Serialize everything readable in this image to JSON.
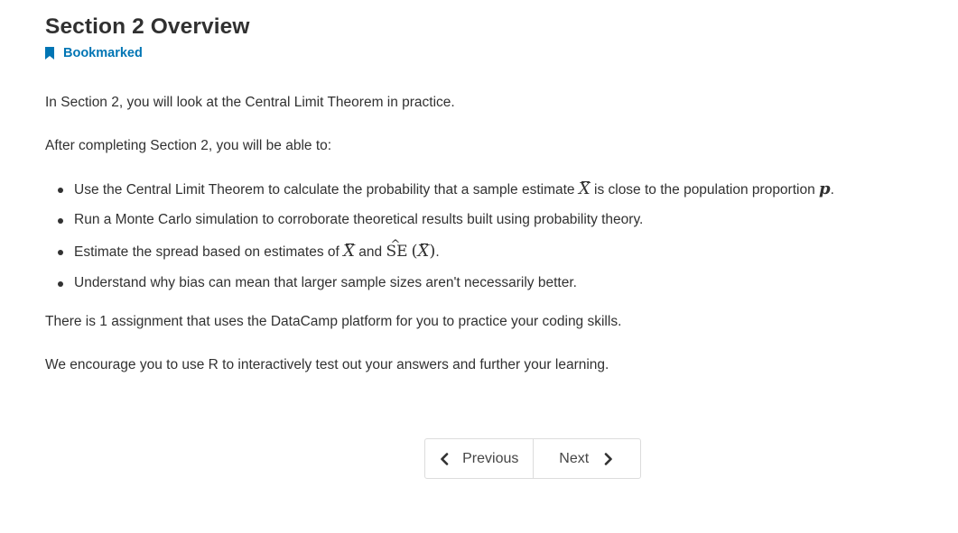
{
  "header": {
    "title": "Section 2 Overview",
    "bookmark_label": "Bookmarked",
    "bookmark_icon": "bookmark-icon"
  },
  "content": {
    "intro": "In Section 2, you will look at the Central Limit Theorem in practice.",
    "objectives_lead": "After completing Section 2, you will be able to:",
    "objectives": [
      {
        "part1": "Use the Central Limit Theorem to calculate the probability that a sample estimate ",
        "math1": "X",
        "part2": " is close to the population proportion ",
        "math2": "p",
        "part3": "."
      },
      {
        "text": "Run a Monte Carlo simulation to corroborate theoretical results built using probability theory."
      },
      {
        "part1": "Estimate the spread based on estimates of ",
        "math1": "X",
        "part2": " and ",
        "se": "SE",
        "open": "(",
        "math2": "X",
        "close": ")",
        "part3": "."
      },
      {
        "text": "Understand why bias can mean that larger sample sizes aren't necessarily better."
      }
    ],
    "assignment_note": "There is 1 assignment that uses the DataCamp platform for you to practice your coding skills.",
    "encouragement": "We encourage you to use R to interactively test out your answers and further your learning."
  },
  "pagination": {
    "previous_label": "Previous",
    "next_label": "Next"
  },
  "colors": {
    "link": "#0075b4",
    "text": "#313131",
    "border": "#dcdcdc"
  }
}
